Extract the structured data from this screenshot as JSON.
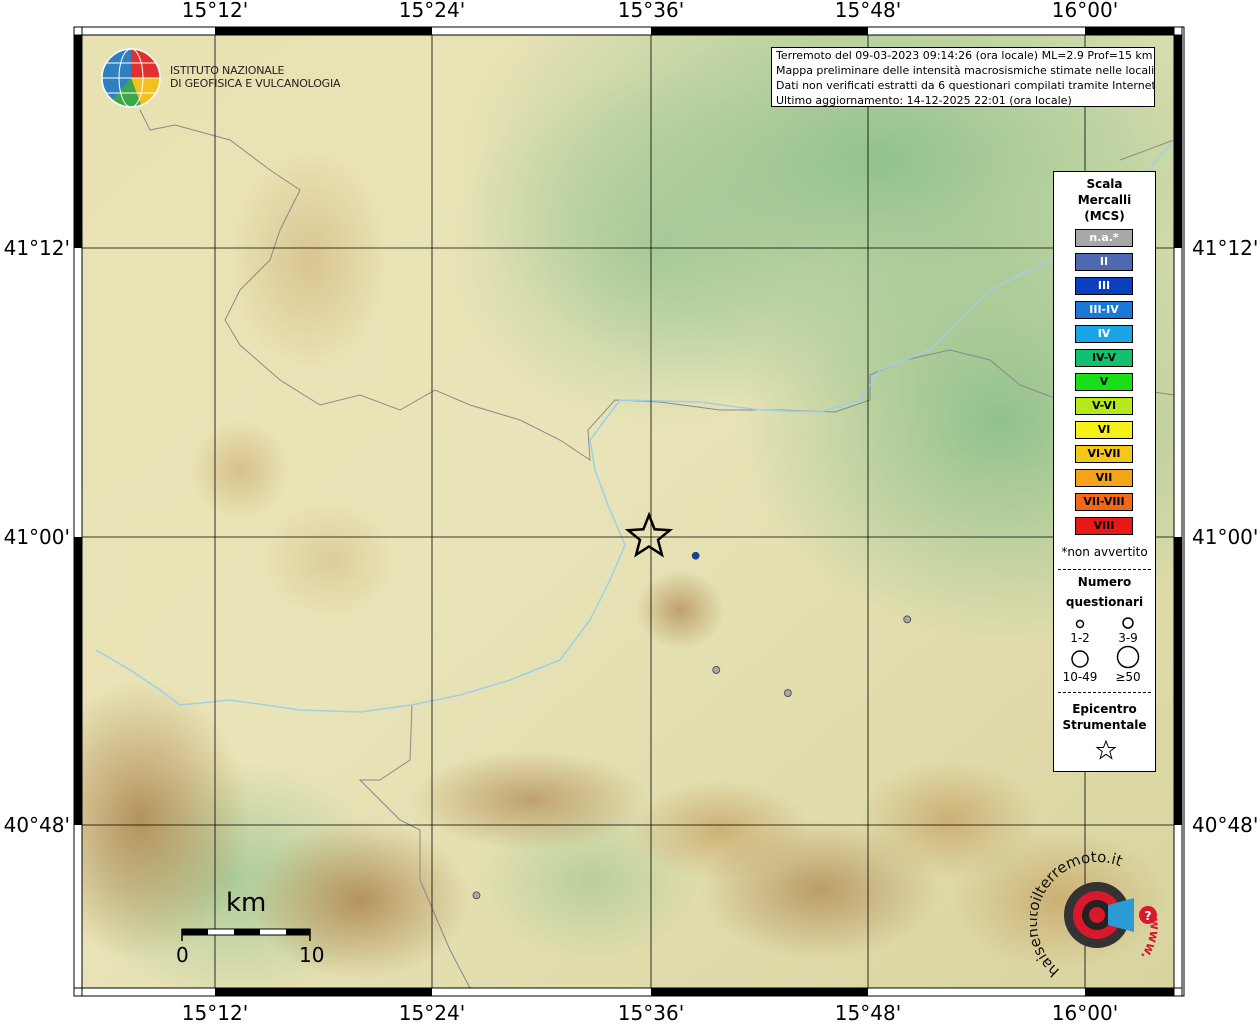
{
  "axes": {
    "longitude_ticks": [
      "15°12'",
      "15°24'",
      "15°36'",
      "15°48'",
      "16°00'"
    ],
    "latitude_ticks": [
      "41°12'",
      "41°00'",
      "40°48'"
    ]
  },
  "logo": {
    "line1": "ISTITUTO NAZIONALE",
    "line2": "DI GEOFISICA E VULCANOLOGIA",
    "icon": "ingv-globe-icon"
  },
  "info": {
    "line1": "Terremoto del 09-03-2023 09:14:26 (ora locale) ML=2.9 Prof=15 km",
    "line2": "Mappa preliminare delle intensità macrosismiche stimate nelle località",
    "line3": "Dati non verificati estratti da 6 questionari compilati tramite Internet.",
    "line4": "Ultimo aggiornamento: 14-12-2025 22:01 (ora locale)"
  },
  "legend": {
    "title1": "Scala",
    "title2": "Mercalli",
    "title3": "(MCS)",
    "classes": [
      {
        "label": "n.a.*",
        "color": "#a8a8a8",
        "text": "#ffffff"
      },
      {
        "label": "II",
        "color": "#4d6ab0",
        "text": "#ffffff"
      },
      {
        "label": "III",
        "color": "#0a3fc0",
        "text": "#ffffff"
      },
      {
        "label": "III-IV",
        "color": "#1a78d8",
        "text": "#ffffff"
      },
      {
        "label": "IV",
        "color": "#1aa6e6",
        "text": "#ffffff"
      },
      {
        "label": "IV-V",
        "color": "#12c070",
        "text": "#000000"
      },
      {
        "label": "V",
        "color": "#18e018",
        "text": "#000000"
      },
      {
        "label": "V-VI",
        "color": "#b4ea18",
        "text": "#000000"
      },
      {
        "label": "VI",
        "color": "#f4f018",
        "text": "#000000"
      },
      {
        "label": "VI-VII",
        "color": "#f4c818",
        "text": "#000000"
      },
      {
        "label": "VII",
        "color": "#f4a418",
        "text": "#000000"
      },
      {
        "label": "VII-VIII",
        "color": "#f06818",
        "text": "#000000"
      },
      {
        "label": "VIII",
        "color": "#e81818",
        "text": "#000000"
      }
    ],
    "note": "*non avvertito",
    "count_title1": "Numero",
    "count_title2": "questionari",
    "count_classes": [
      "1-2",
      "3-9",
      "10-49",
      "≥50"
    ],
    "epicenter_title1": "Epicentro",
    "epicenter_title2": "Strumentale"
  },
  "scalebar": {
    "unit": "km",
    "start": "0",
    "end": "10"
  },
  "brand": {
    "text": "haisentitoilterremoto.it",
    "url_text": "www.",
    "icon": "haisentito-logo-icon"
  },
  "epicenter": {
    "lon": 15.6,
    "lat": 41.0
  },
  "reports": [
    {
      "lon": 15.643,
      "lat": 40.987,
      "color": "#0a3fc0",
      "intensity": "III"
    },
    {
      "lon": 15.838,
      "lat": 40.943,
      "color": "#a8a8a8",
      "intensity": "n.a."
    },
    {
      "lon": 15.662,
      "lat": 40.908,
      "color": "#a8a8a8",
      "intensity": "n.a."
    },
    {
      "lon": 15.728,
      "lat": 40.892,
      "color": "#a8a8a8",
      "intensity": "n.a."
    },
    {
      "lon": 15.441,
      "lat": 40.752,
      "color": "#a8a8a8",
      "intensity": "n.a."
    }
  ],
  "colors": {
    "river": "#9fd0e6",
    "border": "#8a8a8a",
    "frame": "#000000"
  }
}
